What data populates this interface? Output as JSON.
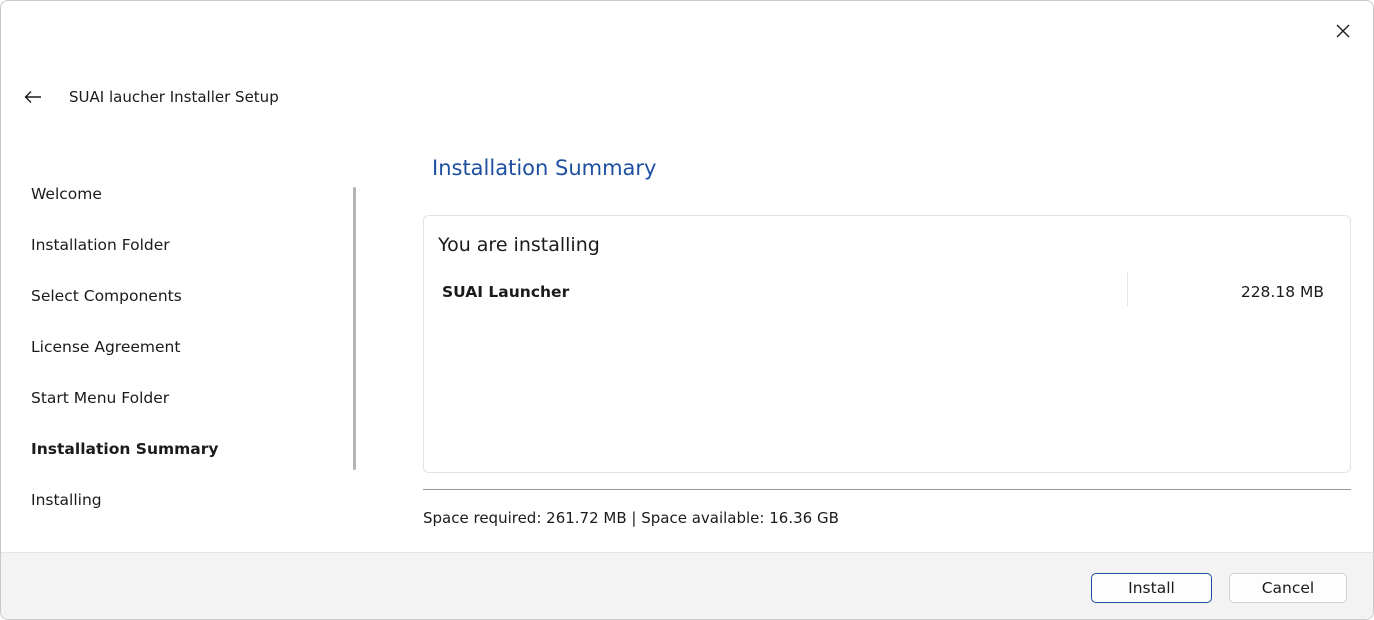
{
  "window": {
    "close_icon": "close-icon"
  },
  "titlebar": {
    "back_icon": "back-arrow-icon",
    "title": "SUAI laucher Installer Setup"
  },
  "sidebar": {
    "items": [
      {
        "label": "Welcome",
        "active": false
      },
      {
        "label": "Installation Folder",
        "active": false
      },
      {
        "label": "Select Components",
        "active": false
      },
      {
        "label": "License Agreement",
        "active": false
      },
      {
        "label": "Start Menu Folder",
        "active": false
      },
      {
        "label": "Installation Summary",
        "active": true
      },
      {
        "label": "Installing",
        "active": false
      }
    ]
  },
  "main": {
    "title": "Installation Summary",
    "summary": {
      "heading": "You are installing",
      "components": [
        {
          "name": "SUAI Launcher",
          "size": "228.18 MB"
        }
      ]
    },
    "space_info": "Space required: 261.72 MB  |  Space available: 16.36 GB"
  },
  "footer": {
    "install_label": "Install",
    "cancel_label": "Cancel"
  },
  "colors": {
    "accent": "#1f4fa0",
    "footer_bg": "#f3f3f3"
  }
}
